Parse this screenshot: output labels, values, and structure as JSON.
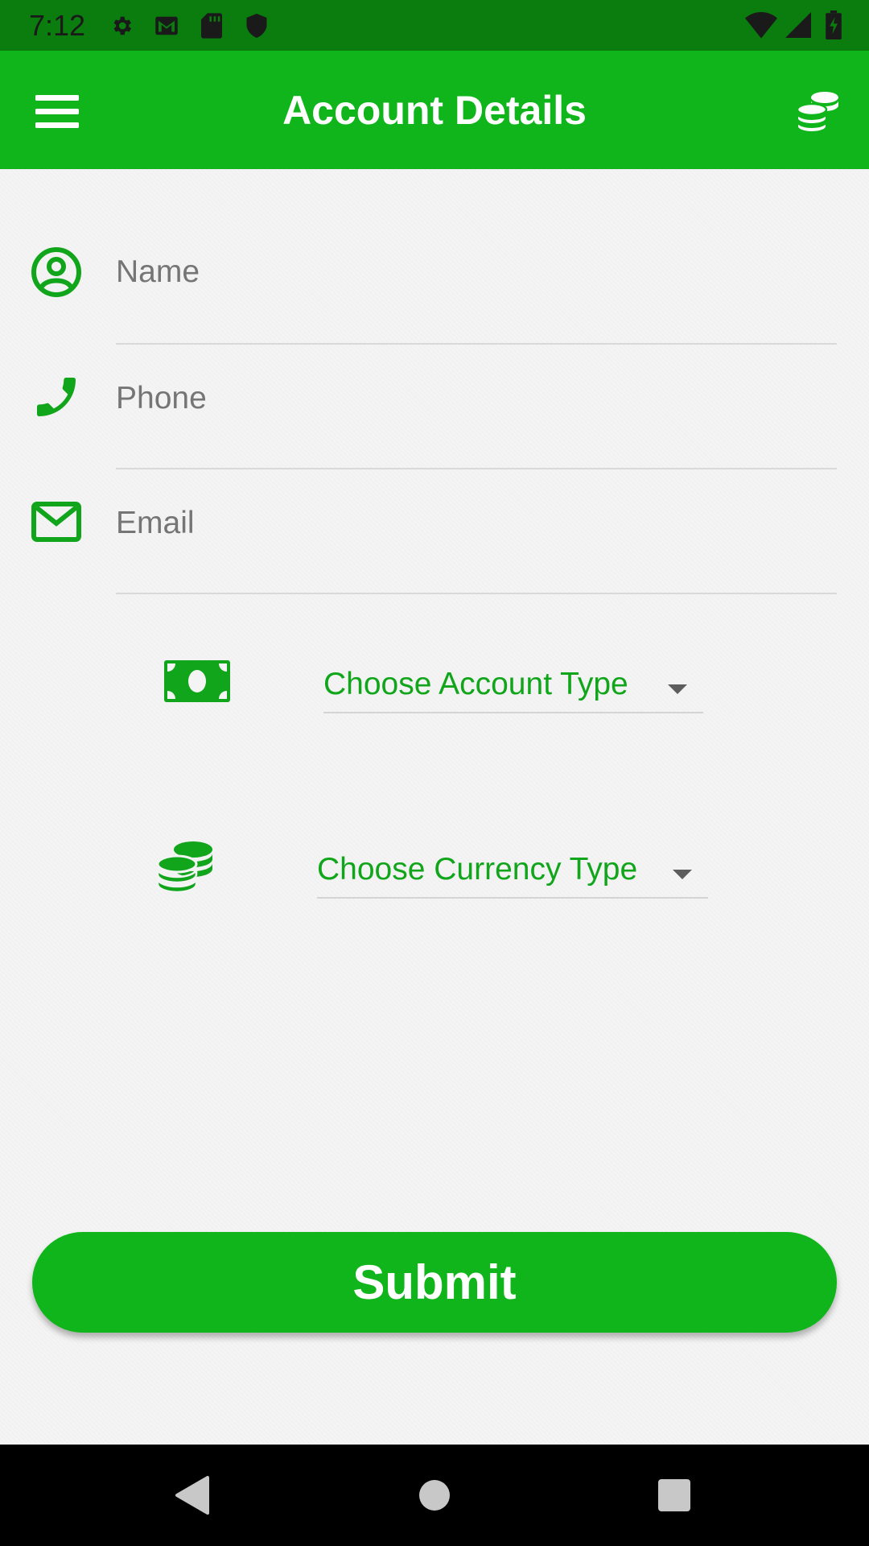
{
  "status_bar": {
    "time": "7:12",
    "icons": [
      "gear-icon",
      "gmail-icon",
      "sd-card-icon",
      "shield-icon"
    ],
    "right_icons": [
      "wifi-icon",
      "signal-icon",
      "battery-icon"
    ]
  },
  "app_bar": {
    "title": "Account Details",
    "menu_icon": "menu-icon",
    "action_icon": "coins-icon"
  },
  "form": {
    "name_placeholder": "Name",
    "phone_placeholder": "Phone",
    "email_placeholder": "Email",
    "account_type_label": "Choose Account Type",
    "currency_type_label": "Choose Currency Type"
  },
  "submit_label": "Submit",
  "colors": {
    "primary": "#0fb51a",
    "status_bar": "#0b7d0e",
    "accent_text": "#11a51b"
  },
  "nav_bar": {
    "icons": [
      "back-icon",
      "home-icon",
      "recents-icon"
    ]
  }
}
